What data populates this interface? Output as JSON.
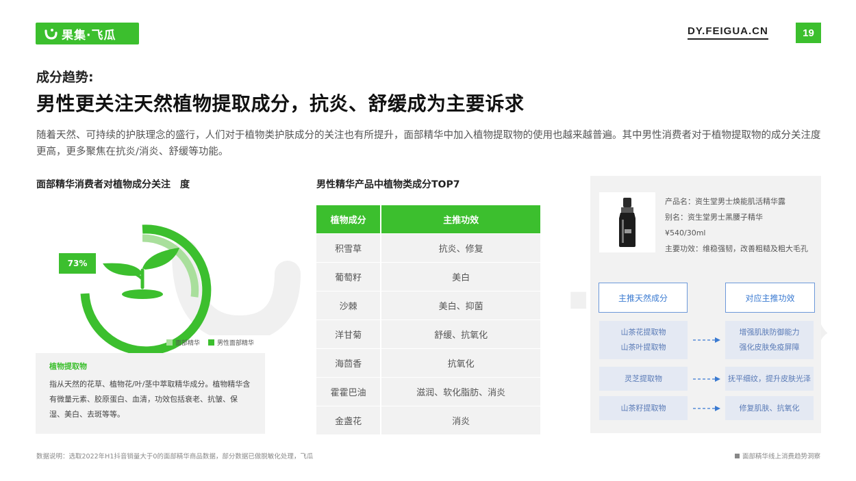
{
  "header": {
    "brand_text": "果集·飞瓜",
    "site_url": "DY.FEIGUA.CN",
    "page_number": "19",
    "brand_color": "#3cbf2e"
  },
  "section_label": "成分趋势:",
  "title": "男性更关注天然植物提取成分，抗炎、舒缓成为主要诉求",
  "intro": "随着天然、可持续的护肤理念的盛行，人们对于植物类护肤成分的关注也有所提升，面部精华中加入植物提取物的使用也越来越普遍。其中男性消费者对于植物提取物的成分关注度更高，更多聚焦在抗炎/消炎、舒缓等功能。",
  "watermark": "果集·飞瓜",
  "donut": {
    "title": "面部精华消费者对植物成分关注　度",
    "badge": "73%",
    "legend": [
      {
        "name": "面部精华",
        "color": "#a9df9c"
      },
      {
        "name": "男性面部精华",
        "color": "#3cbf2e"
      }
    ],
    "icon": "sprout-icon"
  },
  "definition": {
    "title": "植物提取物",
    "body": "指从天然的花草、植物花/叶/茎中萃取精华成分。植物精华含有微量元素、胶原蛋白、血清，功效包括衰老、抗皱、保湿、美白、去斑等等。"
  },
  "table": {
    "title": "男性精华产品中植物类成分TOP7",
    "headers": [
      "植物成分",
      "主推功效"
    ],
    "rows": [
      [
        "积雪草",
        "抗炎、修复"
      ],
      [
        "葡萄籽",
        "美白"
      ],
      [
        "沙棘",
        "美白、抑菌"
      ],
      [
        "洋甘菊",
        "舒缓、抗氧化"
      ],
      [
        "海茴香",
        "抗氧化"
      ],
      [
        "霍霍巴油",
        "滋润、软化脂肪、消炎"
      ],
      [
        "金盏花",
        "消炎"
      ]
    ]
  },
  "product": {
    "name_line": "产品名：资生堂男士焕能肌活精华露",
    "alias_line": "别名：资生堂男士黑腰子精华",
    "price_line": "¥540/30ml",
    "effect_line": "主要功效：维稳强韧，改善粗糙及粗大毛孔",
    "image_icon": "serum-bottle-icon"
  },
  "mapping": {
    "left_header": "主推天然成分",
    "right_header": "对应主推功效",
    "rows": [
      {
        "left": [
          "山茶花提取物",
          "山茶叶提取物"
        ],
        "right": [
          "增强肌肤防御能力",
          "强化皮肤免疫屏障"
        ]
      },
      {
        "left": [
          "灵芝提取物"
        ],
        "right": [
          "抚平细纹，提升皮肤光泽"
        ]
      },
      {
        "left": [
          "山茶籽提取物"
        ],
        "right": [
          "修复肌肤、抗氧化"
        ]
      }
    ],
    "arrow_color": "#3a7ad1"
  },
  "footer": {
    "note": "数据说明：选取2022年H1抖音销量大于0的面部精华商品数据，部分数据已做脱敏化处理，飞瓜",
    "right": "面部精华线上消费趋势洞察"
  }
}
